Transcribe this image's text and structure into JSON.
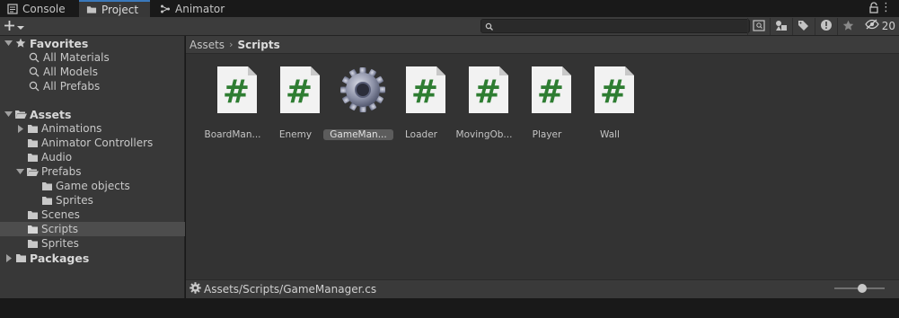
{
  "tabs": [
    {
      "label": "Console",
      "icon": "console-icon",
      "active": false
    },
    {
      "label": "Project",
      "icon": "folder-icon",
      "active": true
    },
    {
      "label": "Animator",
      "icon": "animator-icon",
      "active": false
    }
  ],
  "toolbar": {
    "create_label": "+",
    "search_placeholder": "",
    "hidden_count": "20"
  },
  "tree": {
    "favorites_label": "Favorites",
    "favorites": [
      "All Materials",
      "All Models",
      "All Prefabs"
    ],
    "assets_label": "Assets",
    "assets_children": [
      "Animations",
      "Animator Controllers",
      "Audio",
      "Prefabs",
      "Game objects",
      "Sprites",
      "Scenes",
      "Scripts",
      "Sprites"
    ],
    "packages_label": "Packages"
  },
  "breadcrumb": {
    "root": "Assets",
    "separator": "›",
    "current": "Scripts"
  },
  "assets": [
    {
      "label": "BoardMan...",
      "type": "script"
    },
    {
      "label": "Enemy",
      "type": "script"
    },
    {
      "label": "GameMan...",
      "type": "gear",
      "selected": true
    },
    {
      "label": "Loader",
      "type": "script"
    },
    {
      "label": "MovingOb...",
      "type": "script"
    },
    {
      "label": "Player",
      "type": "script"
    },
    {
      "label": "Wall",
      "type": "script"
    }
  ],
  "status": {
    "path": "Assets/Scripts/GameManager.cs"
  },
  "zoom_level": 0.5,
  "colors": {
    "accent": "#3a79bb",
    "script_hash": "#2e7d32",
    "selected_row": "#4d4d4d"
  }
}
